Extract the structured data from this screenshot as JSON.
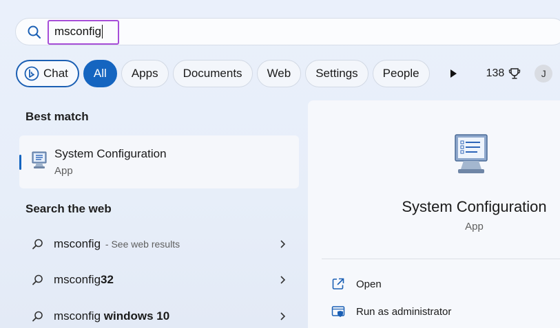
{
  "search": {
    "value": "msconfig"
  },
  "filters": {
    "chat_label": "Chat",
    "items": [
      "All",
      "Apps",
      "Documents",
      "Web",
      "Settings",
      "People"
    ],
    "points": "138",
    "avatar_initial": "J"
  },
  "best_match": {
    "heading": "Best match",
    "title": "System Configuration",
    "subtitle": "App"
  },
  "web": {
    "heading": "Search the web",
    "results": [
      {
        "prefix": "msconfig",
        "bold": "",
        "suffix": " - See web results"
      },
      {
        "prefix": "msconfig",
        "bold": "32",
        "suffix": ""
      },
      {
        "prefix": "msconfig",
        "bold": " windows 10",
        "suffix": ""
      }
    ]
  },
  "detail": {
    "title": "System Configuration",
    "subtitle": "App",
    "actions": [
      "Open",
      "Run as administrator"
    ]
  },
  "colors": {
    "accent": "#1565c0",
    "highlight": "#a64dd8"
  }
}
